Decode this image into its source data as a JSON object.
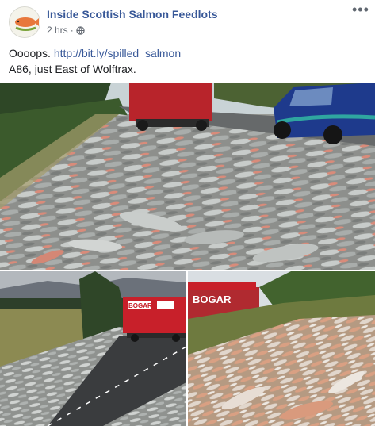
{
  "post": {
    "page_name": "Inside Scottish Salmon Feedlots",
    "time": "2 hrs",
    "separator": "·",
    "privacy_icon": "globe-icon",
    "more_icon": "more-options-icon",
    "text_line1_prefix": "Oooops. ",
    "link": "http://bit.ly/spilled_salmon",
    "text_line2": "A86, just East of Wolftrax."
  },
  "photos": {
    "truck_logo": "BOGAR"
  },
  "colors": {
    "link_blue": "#385898",
    "meta_grey": "#616770",
    "truck_red": "#c8202a"
  }
}
